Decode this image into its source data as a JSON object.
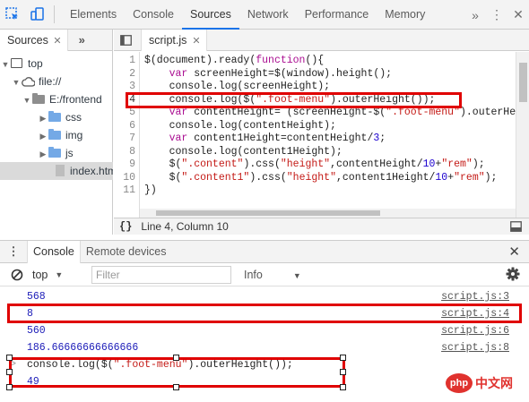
{
  "topbar": {
    "tabs": [
      "Elements",
      "Console",
      "Sources",
      "Network",
      "Performance",
      "Memory"
    ],
    "active_tab": "Sources",
    "more": "»",
    "menu": "⋮",
    "close": "✕"
  },
  "navigator": {
    "tab_label": "Sources",
    "tab_close": "✕",
    "more": "»",
    "tree": {
      "top": "top",
      "origin": "file://",
      "folder_root": "E:/frontend",
      "folders": [
        "css",
        "img",
        "js"
      ],
      "file": "index.html"
    }
  },
  "editor": {
    "file_tab": "script.js",
    "file_close": "✕",
    "lines": [
      {
        "n": "1",
        "code": "$(document).ready(function(){"
      },
      {
        "n": "2",
        "code": "    var screenHeight=$(window).height();"
      },
      {
        "n": "3",
        "code": "    console.log(screenHeight);"
      },
      {
        "n": "4",
        "code": "    console.log($(\".foot-menu\").outerHeight());"
      },
      {
        "n": "5",
        "code": "    var contentHeight= (screenHeight-$(\".foot-menu\").outerHeight"
      },
      {
        "n": "6",
        "code": "    console.log(contentHeight);"
      },
      {
        "n": "7",
        "code": "    var content1Height=contentHeight/3;"
      },
      {
        "n": "8",
        "code": "    console.log(content1Height);"
      },
      {
        "n": "9",
        "code": "    $(\".content\").css(\"height\",contentHeight/10+\"rem\");"
      },
      {
        "n": "10",
        "code": "    $(\".content1\").css(\"height\",content1Height/10+\"rem\");"
      },
      {
        "n": "11",
        "code": "})"
      }
    ],
    "status_braces": "{}",
    "status_position": "Line 4, Column 10"
  },
  "drawer": {
    "more": "⋮",
    "tabs": [
      "Console",
      "Remote devices"
    ],
    "close": "✕"
  },
  "console_toolbar": {
    "context": "top",
    "filter_placeholder": "Filter",
    "level": "Info"
  },
  "console_messages": [
    {
      "value": "568",
      "source": "script.js:3"
    },
    {
      "value": "8",
      "source": "script.js:4"
    },
    {
      "value": "560",
      "source": "script.js:6"
    },
    {
      "value": "186.66666666666666",
      "source": "script.js:8"
    }
  ],
  "console_input": {
    "prompt": ">",
    "code": "console.log($(\".foot-menu\").outerHeight());",
    "result": "49"
  },
  "watermark": {
    "logo": "php",
    "text": "中文网"
  },
  "colors": {
    "highlight_red": "#e00000",
    "active_tab_blue": "#1a73e8",
    "string_red": "#c41a16",
    "number_blue": "#1c1cb8"
  }
}
